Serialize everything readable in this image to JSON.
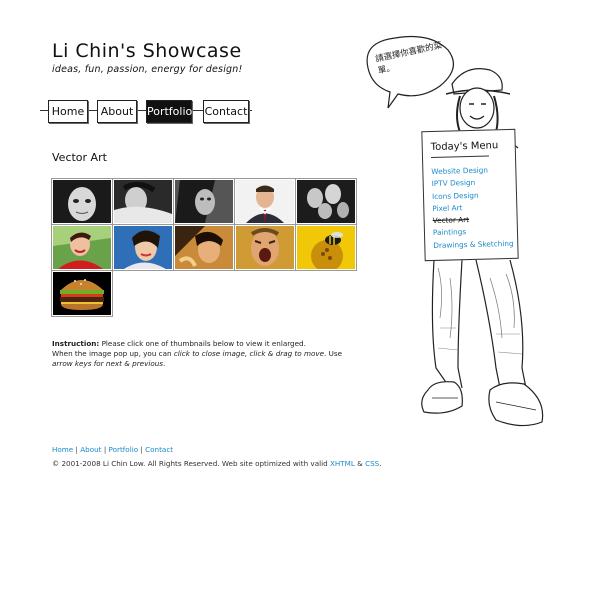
{
  "header": {
    "title": "Li Chin's Showcase",
    "tagline": "ideas, fun, passion, energy for design!"
  },
  "nav": {
    "items": [
      {
        "label": "Home"
      },
      {
        "label": "About"
      },
      {
        "label": "Portfolio"
      },
      {
        "label": "Contact"
      }
    ],
    "active": "Portfolio"
  },
  "section": {
    "title": "Vector Art"
  },
  "gallery": {
    "count": 11,
    "thumbnails": [
      {
        "subject": "girl-face-bw"
      },
      {
        "subject": "woman-reclining-bw"
      },
      {
        "subject": "woman-portrait-bw"
      },
      {
        "subject": "man-suit-color"
      },
      {
        "subject": "family-portrait-bw"
      },
      {
        "subject": "woman-red-top"
      },
      {
        "subject": "woman-blue-background"
      },
      {
        "subject": "woman-yellow-light"
      },
      {
        "subject": "man-shouting"
      },
      {
        "subject": "bee-on-flower"
      },
      {
        "subject": "burger"
      }
    ]
  },
  "instructions": {
    "label": "Instruction:",
    "line1": "Please click one of thumbnails below to view it enlarged.",
    "line2a": "When the image pop up, you can ",
    "line2b": "click to close image, click & drag to move",
    "line2c": ". Use ",
    "line2d": "arrow keys for next & previous",
    "line2e": "."
  },
  "footer": {
    "links": [
      "Home",
      "About",
      "Portfolio",
      "Contact"
    ],
    "separator": "|",
    "copyright": "© 2001-2008 Li Chin Low. All Rights Reserved. Web site optimized with valid ",
    "xhtml": "XHTML",
    "amp": " & ",
    "css": "CSS",
    "end": "."
  },
  "speech_bubble": {
    "text": "請選擇你喜歡的菜單。"
  },
  "menu": {
    "title": "Today's Menu",
    "items": [
      {
        "label": "Website Design",
        "current": false
      },
      {
        "label": "IPTV Design",
        "current": false
      },
      {
        "label": "Icons Design",
        "current": false
      },
      {
        "label": "Pixel Art",
        "current": false
      },
      {
        "label": "Vector Art",
        "current": true
      },
      {
        "label": "Paintings",
        "current": false
      },
      {
        "label": "Drawings & Sketching",
        "current": false
      }
    ]
  },
  "colors": {
    "link": "#1a8acb",
    "text": "#222222",
    "background": "#ffffff"
  }
}
